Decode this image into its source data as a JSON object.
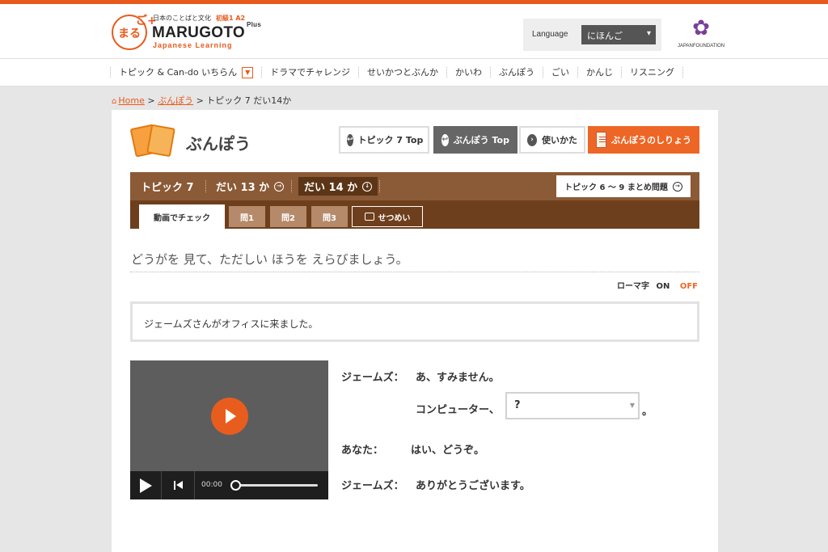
{
  "header": {
    "logo_mark": "まる",
    "logo_mark_plus": "ご+",
    "logo_sub": "日本のことばと文化",
    "logo_level": "初級1 A2",
    "logo_main": "MARUGOTO",
    "logo_plus": "Plus",
    "logo_tagline": "Japanese Learning",
    "language_label": "Language",
    "language_value": "にほんご",
    "partner_logo_text": "JAPANFOUNDATION"
  },
  "nav": {
    "items": [
      {
        "label": "トピック & Can-do いちらん"
      },
      {
        "label": "ドラマでチャレンジ"
      },
      {
        "label": "せいかつとぶんか"
      },
      {
        "label": "かいわ"
      },
      {
        "label": "ぶんぽう"
      },
      {
        "label": "ごい"
      },
      {
        "label": "かんじ"
      },
      {
        "label": "リスニング"
      }
    ]
  },
  "breadcrumb": {
    "home": "Home",
    "sep1": ">",
    "section": "ぶんぽう",
    "sep2": ">",
    "current": "トピック 7 だい14か"
  },
  "section": {
    "title": "ぶんぽう",
    "buttons": {
      "topic_top": "トピック 7 Top",
      "bunpou_top": "ぶんぽう Top",
      "howto": "使いかた",
      "notes": "ぶんぽうのしりょう"
    }
  },
  "lesson_bar": {
    "topic": "トピック 7",
    "lesson13": "だい 13 か",
    "lesson14": "だい 14 か",
    "summary": "トピック 6 ～ 9 まとめ問題"
  },
  "tabs": {
    "video_check": "動画でチェック",
    "q1": "問1",
    "q2": "問2",
    "q3": "問3",
    "explanation": "せつめい"
  },
  "content": {
    "instruction": "どうがを 見て、ただしい ほうを えらびましょう。",
    "romaji_label": "ローマ字",
    "romaji_on": "ON",
    "romaji_off": "OFF",
    "scene": "ジェームズさんがオフィスに来ました。"
  },
  "video": {
    "time": "00:00",
    "progress": 0
  },
  "dialogue": {
    "speaker1": "ジェームズ：",
    "line1": "あ、すみません。",
    "line2_prefix": "コンピューター、",
    "dropdown_value": "?",
    "line2_suffix": "。",
    "speaker2": "あなた：",
    "line3": "はい、どうぞ。",
    "speaker3": "ジェームズ：",
    "line4": "ありがとうございます。"
  },
  "colors": {
    "accent": "#e8591c",
    "brown_bar": "#8b5a36",
    "tab_bar": "#6e3f1c",
    "active_lesson": "#5b3516",
    "button_orange": "#ee6625"
  }
}
